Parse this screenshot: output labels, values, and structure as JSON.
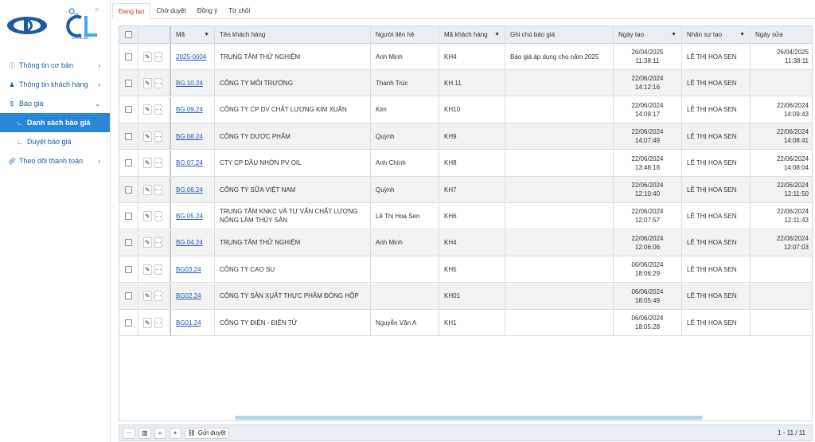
{
  "logo": {
    "sub_text": "CenLab"
  },
  "sidebar": {
    "items": [
      {
        "label": "Thông tin cơ bản",
        "icon": "info-icon",
        "chevron": "›"
      },
      {
        "label": "Thông tin khách hàng",
        "icon": "users-icon",
        "chevron": "›"
      },
      {
        "label": "Báo giá",
        "icon": "dollar-icon",
        "chevron": "⌄"
      },
      {
        "label": "Danh sách báo giá",
        "icon": "sub-branch-icon"
      },
      {
        "label": "Duyệt báo giá",
        "icon": "sub-branch-icon"
      },
      {
        "label": "Theo dõi thanh toán",
        "icon": "link-icon",
        "chevron": "›"
      }
    ]
  },
  "tabs": [
    "Đang tạo",
    "Chờ duyệt",
    "Đồng ý",
    "Từ chối"
  ],
  "table": {
    "headers": {
      "code": "Mã",
      "customer": "Tên khách hàng",
      "contact": "Người liên hệ",
      "customer_code": "Mã khách hàng",
      "note": "Ghi chú báo giá",
      "created": "Ngày tạo",
      "staff": "Nhân sự tạo",
      "edited": "Ngày sửa"
    },
    "rows": [
      {
        "code": "2025-0004",
        "customer": "TRUNG TÂM THỬ NGHIỆM",
        "contact": "Anh Minh",
        "customer_code": "KH4",
        "note": "Báo giá áp dụng cho năm 2025",
        "created_date": "26/04/2025",
        "created_time": "11:38:11",
        "staff": "LÊ THỊ HOA SEN",
        "edited_date": "26/04/2025",
        "edited_time": "11:38:11"
      },
      {
        "code": "BG.10.24",
        "customer": "CÔNG TY MÔI TRƯỜNG",
        "contact": "Thanh Trúc",
        "customer_code": "KH.11",
        "note": "",
        "created_date": "22/06/2024",
        "created_time": "14:12:16",
        "staff": "LÊ THỊ HOA SEN",
        "edited_date": "",
        "edited_time": ""
      },
      {
        "code": "BG.09.24",
        "customer": "CÔNG TY CP DV CHẤT LƯỢNG KIM XUÂN",
        "contact": "Kim",
        "customer_code": "KH10",
        "note": "",
        "created_date": "22/06/2024",
        "created_time": "14:09:17",
        "staff": "LÊ THỊ HOA SEN",
        "edited_date": "22/06/2024",
        "edited_time": "14:09:43"
      },
      {
        "code": "BG.08.24",
        "customer": "CÔNG TY DƯỢC PHẨM",
        "contact": "Quỳnh",
        "customer_code": "KH9",
        "note": "",
        "created_date": "22/06/2024",
        "created_time": "14:07:49",
        "staff": "LÊ THỊ HOA SEN",
        "edited_date": "22/06/2024",
        "edited_time": "14:08:41"
      },
      {
        "code": "BG.07.24",
        "customer": "CTY CP DẦU NHỜN PV OIL",
        "contact": "Anh Chính",
        "customer_code": "KH8",
        "note": "",
        "created_date": "22/06/2024",
        "created_time": "13:48:18",
        "staff": "LÊ THỊ HOA SEN",
        "edited_date": "22/06/2024",
        "edited_time": "14:08:04"
      },
      {
        "code": "BG.06.24",
        "customer": "CÔNG TY SỮA VIỆT NAM",
        "contact": "Quỳnh",
        "customer_code": "KH7",
        "note": "",
        "created_date": "22/06/2024",
        "created_time": "12:10:40",
        "staff": "LÊ THỊ HOA SEN",
        "edited_date": "22/06/2024",
        "edited_time": "12:11:50"
      },
      {
        "code": "BG.05.24",
        "customer": "TRUNG TÂM KNKC VÀ TƯ VẤN CHẤT LƯỢNG NÔNG LÂM THỦY SẢN",
        "contact": "Lê Thị Hoa Sen",
        "customer_code": "KH6",
        "note": "",
        "created_date": "22/06/2024",
        "created_time": "12:07:57",
        "staff": "LÊ THỊ HOA SEN",
        "edited_date": "22/06/2024",
        "edited_time": "12:11:43"
      },
      {
        "code": "BG.04.24",
        "customer": "TRUNG TÂM THỬ NGHIỆM",
        "contact": "Anh Minh",
        "customer_code": "KH4",
        "note": "",
        "created_date": "22/06/2024",
        "created_time": "12:06:06",
        "staff": "LÊ THỊ HOA SEN",
        "edited_date": "22/06/2024",
        "edited_time": "12:07:03"
      },
      {
        "code": "BG03.24",
        "customer": "CÔNG TY CAO SU",
        "contact": "",
        "customer_code": "KH5",
        "note": "",
        "created_date": "06/06/2024",
        "created_time": "18:06:29",
        "staff": "LÊ THỊ HOA SEN",
        "edited_date": "",
        "edited_time": ""
      },
      {
        "code": "BG02.24",
        "customer": "CÔNG TY SẢN XUẤT THỰC PHẨM ĐÓNG HỘP",
        "contact": "",
        "customer_code": "KH01",
        "note": "",
        "created_date": "06/06/2024",
        "created_time": "18:05:49",
        "staff": "LÊ THỊ HOA SEN",
        "edited_date": "",
        "edited_time": ""
      },
      {
        "code": "BG01.24",
        "customer": "CÔNG TY ĐIỆN - ĐIỆN TỬ",
        "contact": "Nguyễn Văn A",
        "customer_code": "KH1",
        "note": "",
        "created_date": "06/06/2024",
        "created_time": "18:05:28",
        "staff": "LÊ THỊ HOA SEN",
        "edited_date": "",
        "edited_time": ""
      }
    ]
  },
  "footer": {
    "more": "···",
    "columns": "▥",
    "search": "⌕",
    "add": "+",
    "send_label": "Gửi duyệt",
    "paging": "1 - 11 / 11"
  },
  "colors": {
    "accent": "#2a86d8",
    "link": "#1f57b8",
    "active_tab": "#d0342c"
  }
}
